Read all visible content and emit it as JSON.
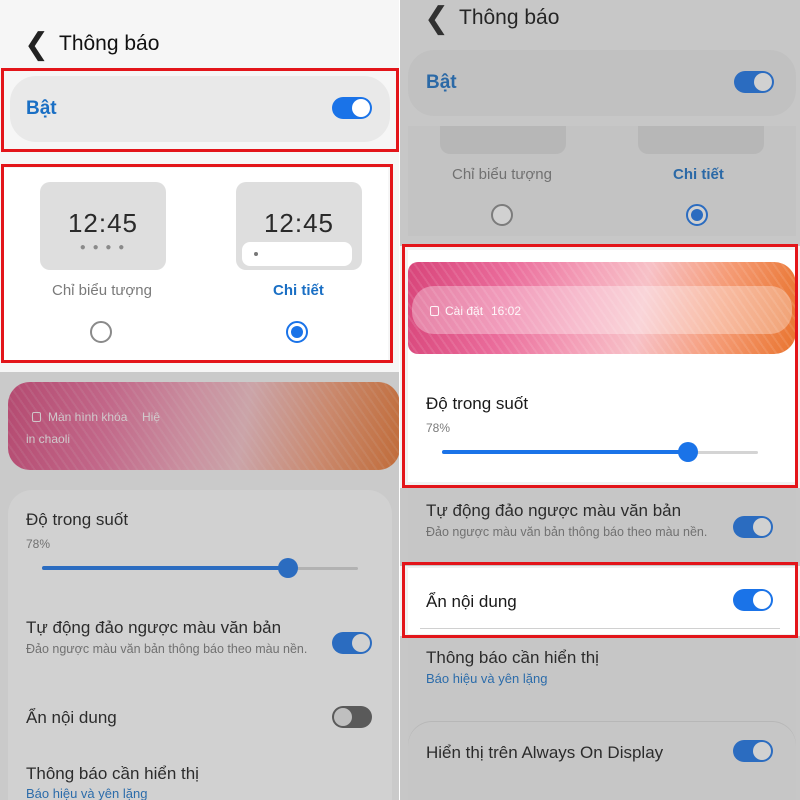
{
  "colors": {
    "accent": "#1a73e8",
    "highlight": "#e3151a",
    "link": "#1a73c9"
  },
  "icons": {
    "back": "chevron-left-icon"
  },
  "glyphs": {
    "back": "❮"
  },
  "left": {
    "header": {
      "title": "Thông báo"
    },
    "master_toggle": {
      "label": "Bật",
      "on": true
    },
    "style_options": [
      {
        "time": "12:45",
        "label": "Chỉ biểu tượng",
        "selected": false
      },
      {
        "time": "12:45",
        "label": "Chi tiết",
        "selected": true
      }
    ],
    "wallpaper_preview": {
      "line1": "Màn hình khóa",
      "line1_suffix": "Hiệ",
      "line2": "in chaoli"
    },
    "transparency": {
      "label": "Độ trong suốt",
      "value_text": "78%",
      "value": 0.78
    },
    "auto_invert": {
      "label": "Tự động đảo ngược màu văn bản",
      "desc": "Đảo ngược màu văn bản thông báo theo màu nền.",
      "on": true
    },
    "hide_content": {
      "label": "Ẩn nội dung",
      "on": false
    },
    "notify_to_show": {
      "label": "Thông báo cần hiển thị",
      "value": "Báo hiệu và yên lặng"
    }
  },
  "right": {
    "header": {
      "title": "Thông báo"
    },
    "master_toggle": {
      "label": "Bật",
      "on": true
    },
    "style_options": [
      {
        "label": "Chỉ biểu tượng",
        "selected": false
      },
      {
        "label": "Chi tiết",
        "selected": true
      }
    ],
    "wallpaper_preview": {
      "line1": "Cài đặt",
      "time": "16:02"
    },
    "transparency": {
      "label": "Độ trong suốt",
      "value_text": "78%",
      "value": 0.78
    },
    "auto_invert": {
      "label": "Tự động đảo ngược màu văn bản",
      "desc": "Đảo ngược màu văn bản thông báo theo màu nền.",
      "on": true
    },
    "hide_content": {
      "label": "Ẩn nội dung",
      "on": true
    },
    "notify_to_show": {
      "label": "Thông báo cần hiển thị",
      "value": "Báo hiệu và yên lặng"
    },
    "aod": {
      "label": "Hiển thị trên Always On Display",
      "on": true
    }
  }
}
